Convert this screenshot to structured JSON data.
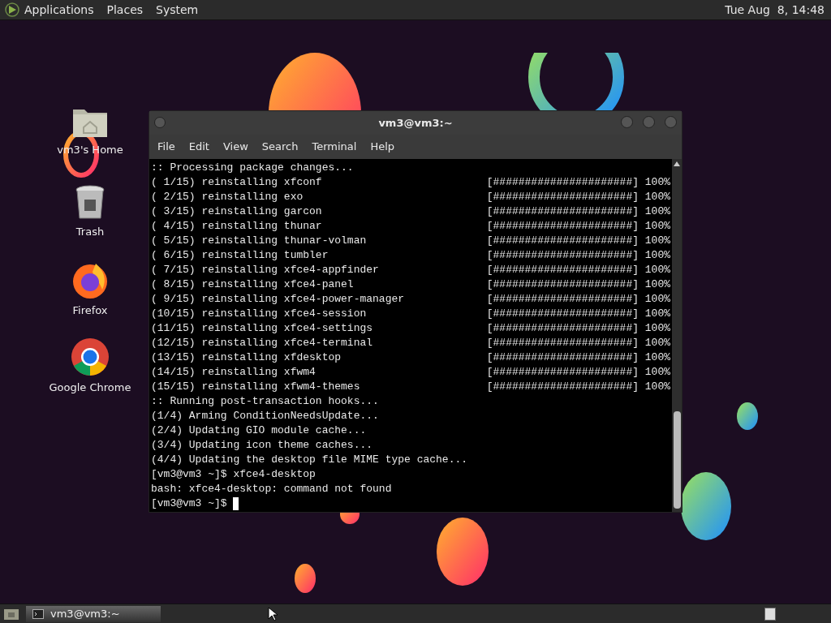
{
  "top_panel": {
    "menus": [
      "Applications",
      "Places",
      "System"
    ],
    "clock": "Tue Aug  8, 14:48"
  },
  "desktop_icons": [
    {
      "kind": "home",
      "label": "vm3's Home"
    },
    {
      "kind": "trash",
      "label": "Trash"
    },
    {
      "kind": "firefox",
      "label": "Firefox"
    },
    {
      "kind": "chrome",
      "label": "Google Chrome"
    }
  ],
  "window": {
    "title": "vm3@vm3:~",
    "menu": [
      "File",
      "Edit",
      "View",
      "Search",
      "Terminal",
      "Help"
    ],
    "lines": [
      {
        "text": ":: Processing package changes..."
      },
      {
        "text": "( 1/15) reinstalling xfconf",
        "progress": "[######################] 100%"
      },
      {
        "text": "( 2/15) reinstalling exo",
        "progress": "[######################] 100%"
      },
      {
        "text": "( 3/15) reinstalling garcon",
        "progress": "[######################] 100%"
      },
      {
        "text": "( 4/15) reinstalling thunar",
        "progress": "[######################] 100%"
      },
      {
        "text": "( 5/15) reinstalling thunar-volman",
        "progress": "[######################] 100%"
      },
      {
        "text": "( 6/15) reinstalling tumbler",
        "progress": "[######################] 100%"
      },
      {
        "text": "( 7/15) reinstalling xfce4-appfinder",
        "progress": "[######################] 100%"
      },
      {
        "text": "( 8/15) reinstalling xfce4-panel",
        "progress": "[######################] 100%"
      },
      {
        "text": "( 9/15) reinstalling xfce4-power-manager",
        "progress": "[######################] 100%"
      },
      {
        "text": "(10/15) reinstalling xfce4-session",
        "progress": "[######################] 100%"
      },
      {
        "text": "(11/15) reinstalling xfce4-settings",
        "progress": "[######################] 100%"
      },
      {
        "text": "(12/15) reinstalling xfce4-terminal",
        "progress": "[######################] 100%"
      },
      {
        "text": "(13/15) reinstalling xfdesktop",
        "progress": "[######################] 100%"
      },
      {
        "text": "(14/15) reinstalling xfwm4",
        "progress": "[######################] 100%"
      },
      {
        "text": "(15/15) reinstalling xfwm4-themes",
        "progress": "[######################] 100%"
      },
      {
        "text": ":: Running post-transaction hooks..."
      },
      {
        "text": "(1/4) Arming ConditionNeedsUpdate..."
      },
      {
        "text": "(2/4) Updating GIO module cache..."
      },
      {
        "text": "(3/4) Updating icon theme caches..."
      },
      {
        "text": "(4/4) Updating the desktop file MIME type cache..."
      },
      {
        "text": "[vm3@vm3 ~]$ xfce4-desktop"
      },
      {
        "text": "bash: xfce4-desktop: command not found"
      },
      {
        "text": "[vm3@vm3 ~]$ "
      }
    ]
  },
  "taskbar": {
    "tasks": [
      {
        "label": "vm3@vm3:~",
        "selected": true
      }
    ]
  }
}
